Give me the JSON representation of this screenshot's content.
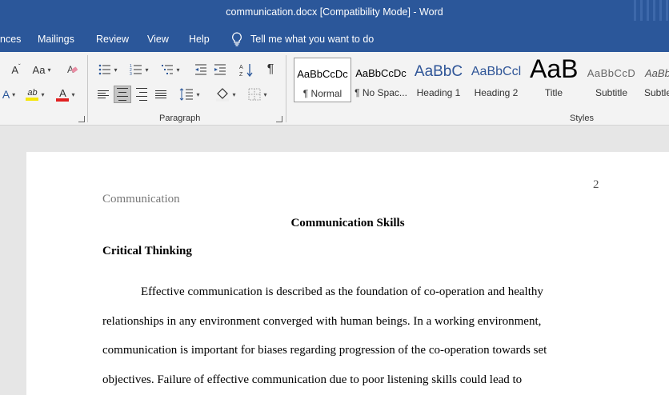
{
  "window": {
    "title": "communication.docx [Compatibility Mode]  -  Word"
  },
  "tabs": {
    "references_partial": "nces",
    "mailings": "Mailings",
    "review": "Review",
    "view": "View",
    "help": "Help",
    "tell_me": "Tell me what you want to do"
  },
  "ribbon": {
    "font": {
      "superscript_glyph": "A",
      "change_case_glyph": "Aa",
      "font_color_glyph": "A",
      "highlight_glyph": "ab",
      "font_color_hex": "#e02020",
      "highlight_color_hex": "#f5e60a"
    },
    "paragraph": {
      "label": "Paragraph",
      "show_marks_glyph": "¶",
      "sort_glyph": "A↓Z"
    },
    "styles": {
      "label": "Styles",
      "items": [
        {
          "preview": "AaBbCcDc",
          "name": "¶ Normal"
        },
        {
          "preview": "AaBbCcDc",
          "name": "¶ No Spac..."
        },
        {
          "preview": "AaBbC",
          "name": "Heading 1"
        },
        {
          "preview": "AaBbCcl",
          "name": "Heading 2"
        },
        {
          "preview": "AaB",
          "name": "Title"
        },
        {
          "preview": "AaBbCcD",
          "name": "Subtitle"
        },
        {
          "preview": "AaBb",
          "name": "Subtle"
        }
      ]
    }
  },
  "document": {
    "page_number": "2",
    "running_head": "Communication",
    "title": "Communication Skills",
    "heading": "Critical Thinking",
    "paragraph_lines": [
      "Effective communication is described as the foundation of co-operation and healthy",
      "relationships in any environment converged with human beings. In a working environment,",
      "communication is important for biases regarding progression of the co-operation towards set",
      "objectives. Failure of effective communication due to poor listening skills could lead to"
    ]
  }
}
